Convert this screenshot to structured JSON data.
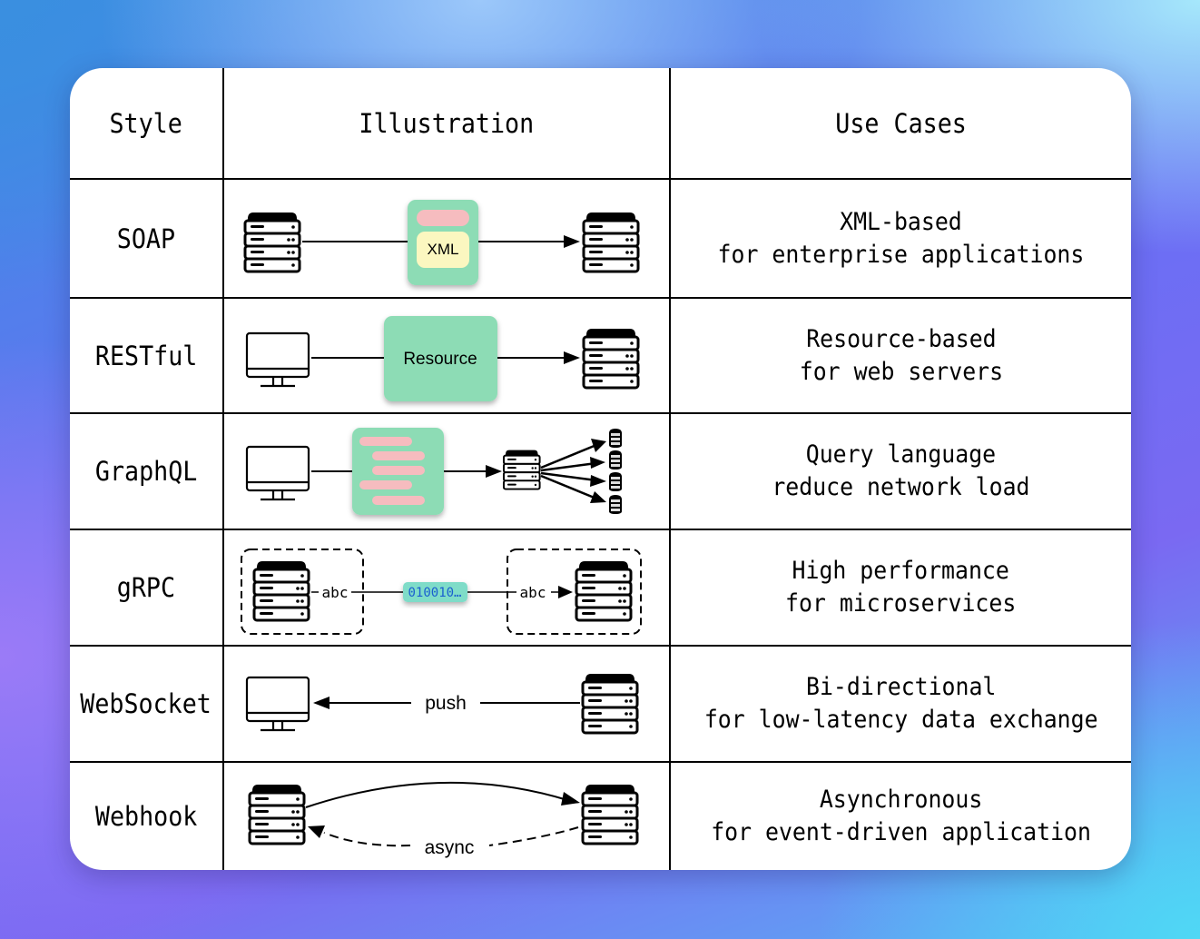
{
  "table": {
    "headers": {
      "style": "Style",
      "illustration": "Illustration",
      "use_cases": "Use Cases"
    },
    "rows": [
      {
        "style": "SOAP",
        "use_case_line1": "XML-based",
        "use_case_line2": "for enterprise applications",
        "illustration": {
          "payload_label": "XML"
        }
      },
      {
        "style": "RESTful",
        "use_case_line1": "Resource-based",
        "use_case_line2": "for web servers",
        "illustration": {
          "payload_label": "Resource"
        }
      },
      {
        "style": "GraphQL",
        "use_case_line1": "Query language",
        "use_case_line2": "reduce network load",
        "illustration": {
          "datastore_count": 4
        }
      },
      {
        "style": "gRPC",
        "use_case_line1": "High performance",
        "use_case_line2": "for microservices",
        "illustration": {
          "left_label": "abc",
          "binary_label": "010010…",
          "right_label": "abc"
        }
      },
      {
        "style": "WebSocket",
        "use_case_line1": "Bi-directional",
        "use_case_line2": "for low-latency data exchange",
        "illustration": {
          "arrow_label": "push"
        }
      },
      {
        "style": "Webhook",
        "use_case_line1": "Asynchronous",
        "use_case_line2": "for event-driven application",
        "illustration": {
          "return_label": "async"
        }
      }
    ]
  },
  "colors": {
    "green_box": "#8ddcb5",
    "pink_bar": "#f6bcbf",
    "yellow_box": "#fbf7c0",
    "binary_box": "#7fdcc8",
    "binary_text": "#1a5fd0"
  }
}
